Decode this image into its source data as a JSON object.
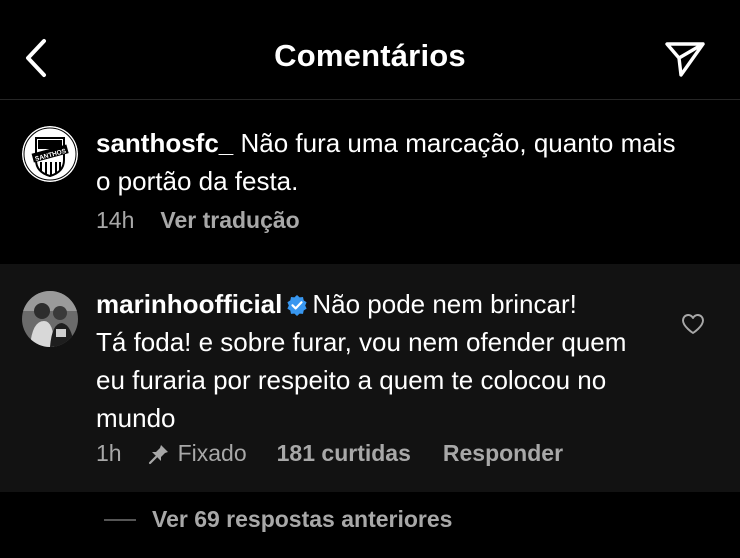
{
  "header": {
    "title": "Comentários",
    "back_icon": "chevron-left-icon",
    "share_icon": "paper-plane-icon"
  },
  "caption_comment": {
    "avatar_text": "SANTHOS",
    "username": "santhosfc_",
    "text": " Não fura uma marcação, quanto mais o portão da festa.",
    "time": "14h",
    "translate": "Ver tradução"
  },
  "reply_comment": {
    "username": "marinhoofficial",
    "verified": true,
    "text_line1": "Não pode nem brincar!",
    "text_rest": "Tá foda! e sobre furar, vou nem ofender quem eu furaria por respeito a quem te colocou no mundo",
    "time": "1h",
    "pinned": "Fixado",
    "likes": "181 curtidas",
    "reply": "Responder"
  },
  "more_replies": "Ver 69 respostas anteriores",
  "colors": {
    "background": "#000000",
    "reply_bg": "#121212",
    "meta": "#a8a8a8",
    "verified": "#3897f0"
  }
}
